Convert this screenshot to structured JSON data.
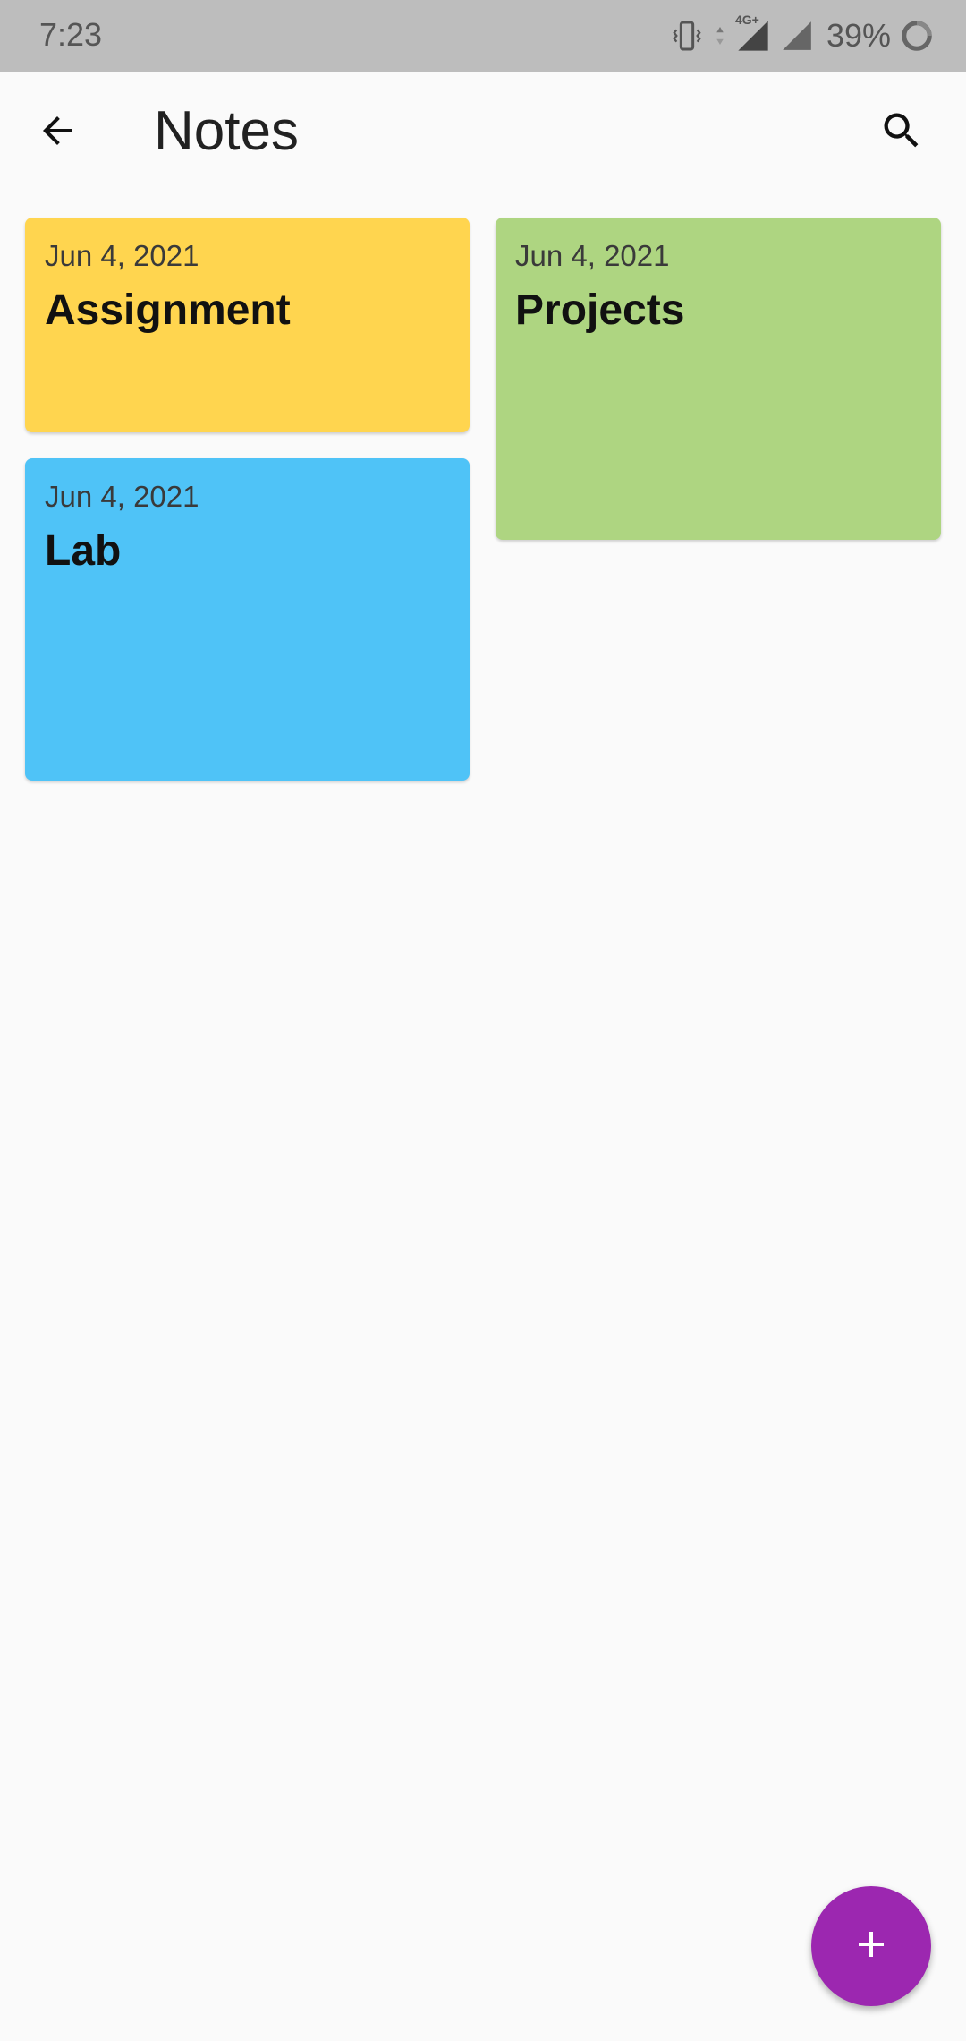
{
  "status_bar": {
    "time": "7:23",
    "battery_percent": "39%",
    "network_label": "4G+",
    "icons": [
      "vibrate-icon",
      "data-arrows-icon",
      "signal-icon",
      "signal-icon",
      "battery-icon"
    ]
  },
  "app_bar": {
    "title": "Notes",
    "back_icon": "arrow-back-icon",
    "search_icon": "search-icon"
  },
  "notes": [
    {
      "date": "Jun 4, 2021",
      "title": "Assignment",
      "color": "#ffd54f"
    },
    {
      "date": "Jun 4, 2021",
      "title": "Projects",
      "color": "#aed581"
    },
    {
      "date": "Jun 4, 2021",
      "title": "Lab",
      "color": "#4fc3f7"
    }
  ],
  "fab": {
    "icon": "add-icon",
    "color": "#9c27b0"
  }
}
